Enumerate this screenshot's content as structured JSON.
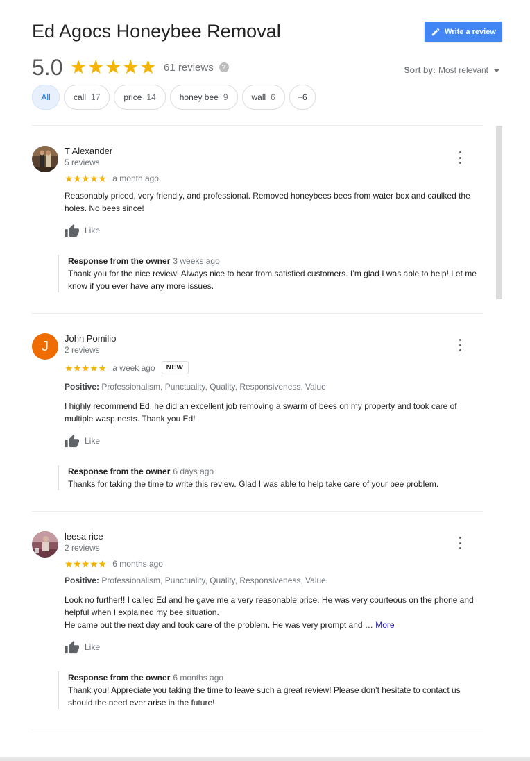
{
  "business": {
    "name": "Ed Agocs Honeybee Removal"
  },
  "write_review": {
    "label": "Write a review"
  },
  "summary": {
    "rating": "5.0",
    "stars": "★★★★★",
    "reviews_label": "61 reviews",
    "help": "?"
  },
  "sort": {
    "label": "Sort by:",
    "value": "Most relevant"
  },
  "chips": [
    {
      "label": "All",
      "count": ""
    },
    {
      "label": "call",
      "count": "17"
    },
    {
      "label": "price",
      "count": "14"
    },
    {
      "label": "honey bee",
      "count": "9"
    },
    {
      "label": "wall",
      "count": "6"
    },
    {
      "label": "+6",
      "count": ""
    }
  ],
  "reviews": [
    {
      "name": "T Alexander",
      "sub": "5 reviews",
      "stars": "★★★★★",
      "when": "a month ago",
      "text": "Reasonably priced, very friendly, and professional.  Removed honeybees bees from water box and caulked the holes. No bees since!",
      "like": "Like",
      "response": {
        "label": "Response from the owner",
        "when": "3 weeks ago",
        "text": "Thank you for the nice review! Always nice to hear from satisfied customers. I’m glad I was able to help! Let me know if you ever have any more issues."
      }
    },
    {
      "name": "John Pomilio",
      "sub": "2 reviews",
      "avatar_letter": "J",
      "stars": "★★★★★",
      "when": "a week ago",
      "badge": "NEW",
      "positive_label": "Positive:",
      "positive": "Professionalism, Punctuality, Quality, Responsiveness, Value",
      "text": "I highly recommend Ed, he did an excellent job removing a swarm of bees on my property and took care of multiple wasp nests. Thank you Ed!",
      "like": "Like",
      "response": {
        "label": "Response from the owner",
        "when": "6 days ago",
        "text": "Thanks for taking the time to write this review. Glad I was able to help take care of your bee problem."
      }
    },
    {
      "name": "leesa rice",
      "sub": "2 reviews",
      "stars": "★★★★★",
      "when": "6 months ago",
      "positive_label": "Positive:",
      "positive": "Professionalism, Punctuality, Quality, Responsiveness, Value",
      "text1": "Look no further!! I called Ed and he gave me a very reasonable price. He was very courteous on the phone and helpful when I explained my bee situation.",
      "text2": "He came out the next day and took care of the problem. He was very prompt and … ",
      "more": "More",
      "like": "Like",
      "response": {
        "label": "Response from the owner",
        "when": "6 months ago",
        "text": "Thank you! Appreciate you taking the time to leave such a great review! Please don’t hesitate to contact us should the need ever arise in the future!"
      }
    }
  ],
  "colors": {
    "accent": "#4285f4",
    "star": "#f4b400",
    "avatar_j": "#ef6c00",
    "chip_active_bg": "#e8f0fe",
    "link": "#1a0dab"
  }
}
